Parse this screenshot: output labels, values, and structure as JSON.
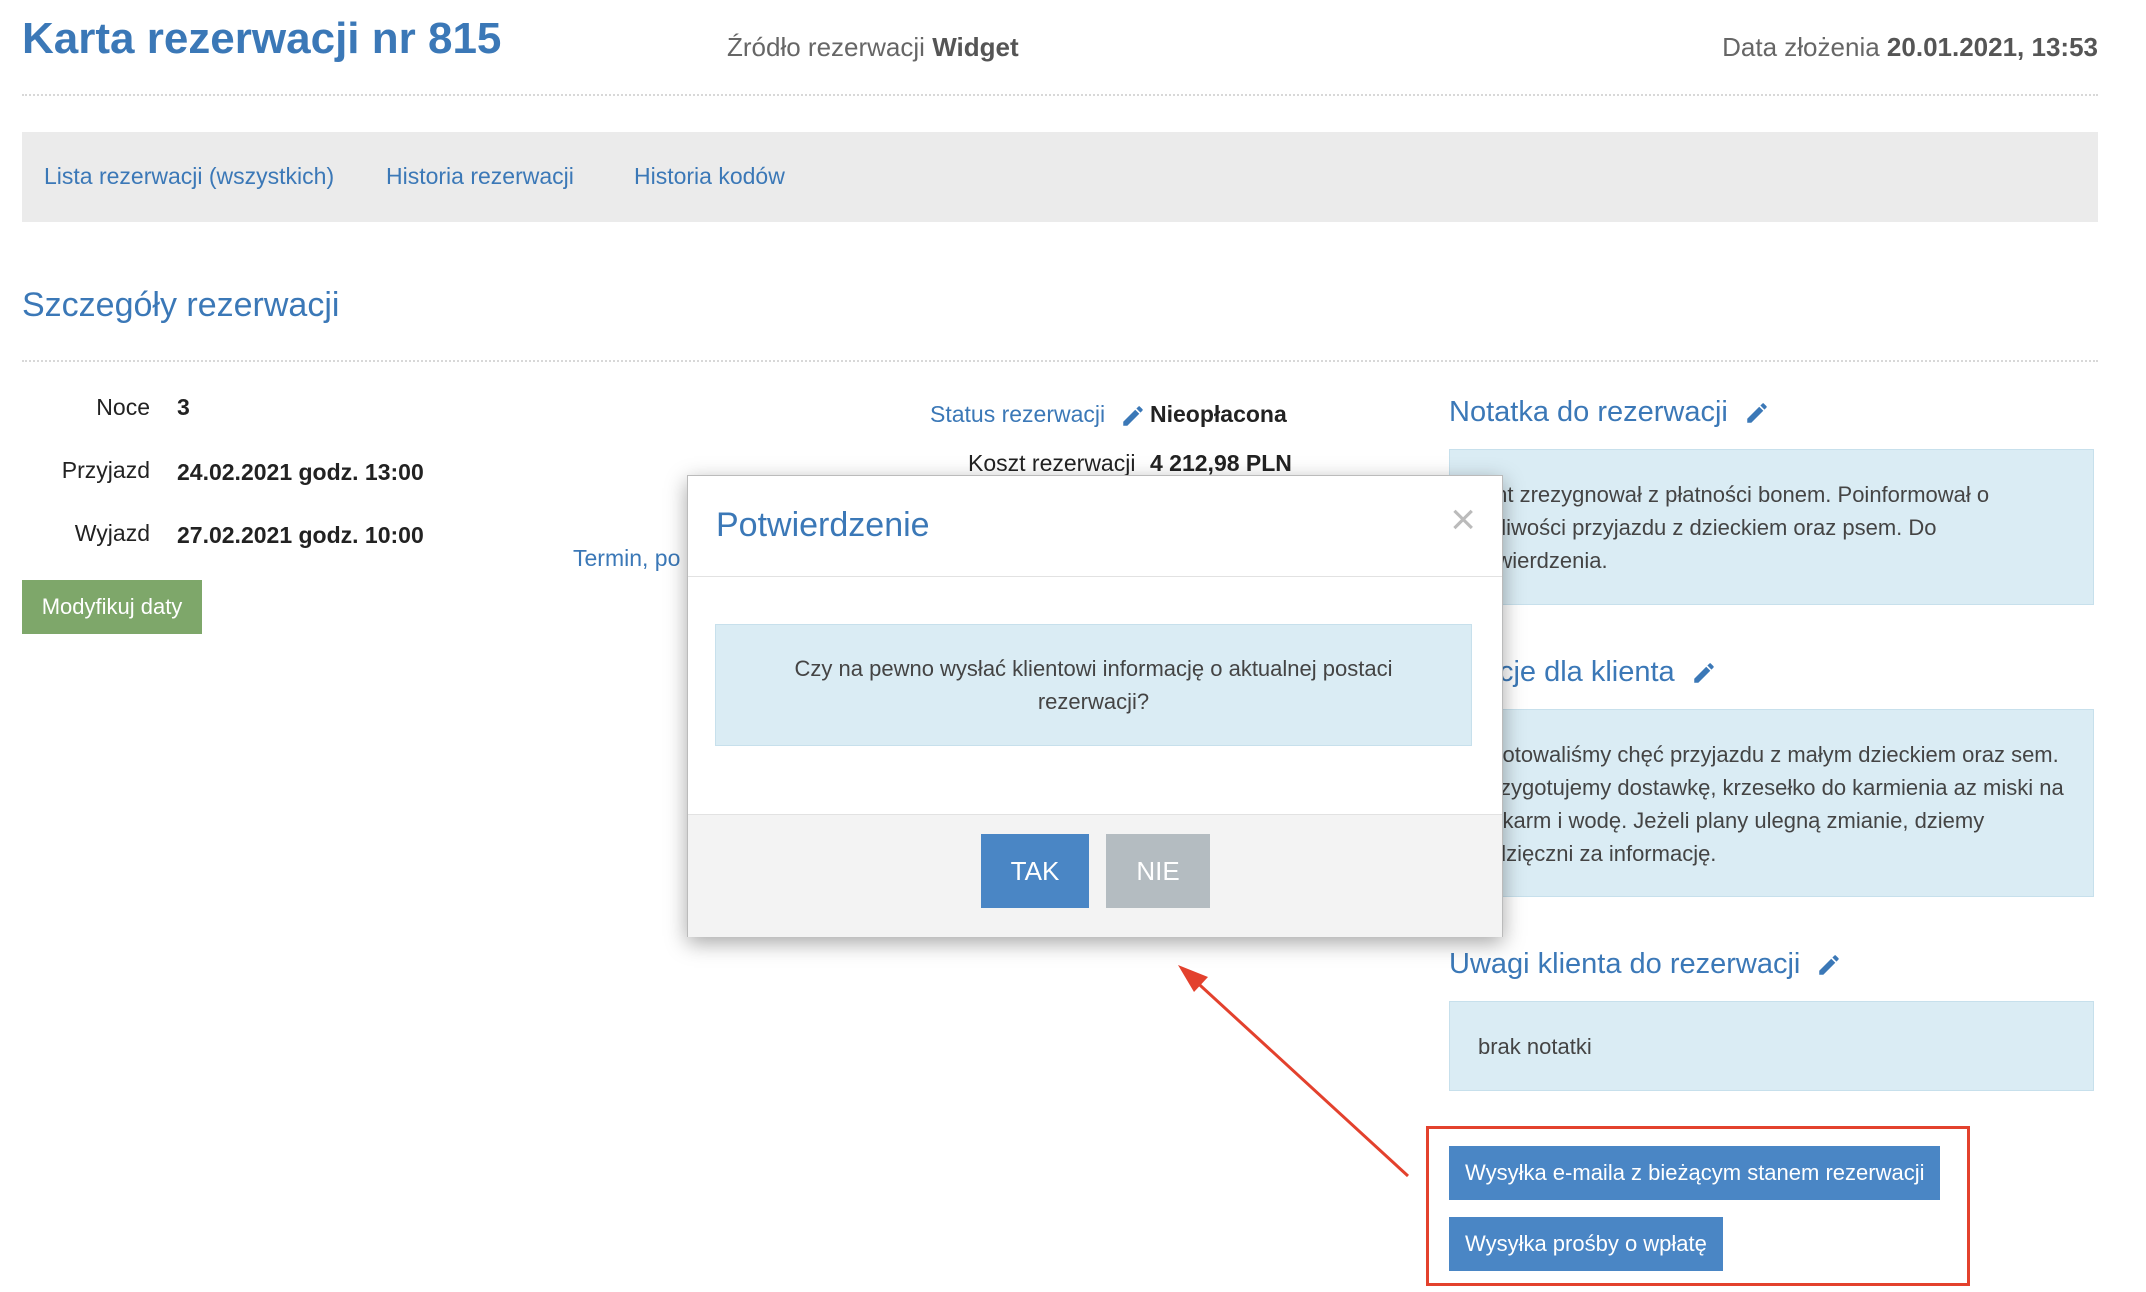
{
  "header": {
    "title": "Karta rezerwacji nr 815",
    "source_label": "Źródło rezerwacji",
    "source_value": "Widget",
    "date_label": "Data złożenia",
    "date_value": "20.01.2021, 13:53"
  },
  "nav": {
    "items": [
      {
        "label": "Lista rezerwacji (wszystkich)"
      },
      {
        "label": "Historia rezerwacji"
      },
      {
        "label": "Historia kodów"
      }
    ]
  },
  "details": {
    "section_title": "Szczegóły rezerwacji",
    "nights_label": "Noce",
    "nights_value": "3",
    "arrival_label": "Przyjazd",
    "arrival_value": "24.02.2021 godz. 13:00",
    "departure_label": "Wyjazd",
    "departure_value": "27.02.2021 godz. 10:00",
    "modify_button": "Modyfikuj daty",
    "status_label": "Status rezerwacji",
    "status_value": "Nieopłacona",
    "cost_label": "Koszt rezerwacji",
    "cost_value": "4 212,98 PLN",
    "termin_text": "Termin, po"
  },
  "right": {
    "note_title": "Notatka do rezerwacji",
    "note_text": "ient zrezygnował z płatności bonem. Poinformował o ożliwości przyjazdu z dzieckiem oraz psem. Do otwierdzenia.",
    "client_info_title": "rmacje dla klienta",
    "client_info_text": "dnotowaliśmy chęć przyjazdu z małym dzieckiem oraz sem. Przygotujemy dostawkę, krzesełko do karmienia az miski na pokarm i wodę. Jeżeli plany ulegną zmianie, dziemy wdzięczni za informację.",
    "remarks_title": "Uwagi klienta do rezerwacji",
    "remarks_text": "brak notatki",
    "send_email_button": "Wysyłka e-maila z bieżącym stanem rezerwacji",
    "send_payment_button": "Wysyłka prośby o wpłatę"
  },
  "modal": {
    "title": "Potwierdzenie",
    "close_symbol": "×",
    "message": "Czy na pewno wysłać klientowi informację o aktualnej postaci rezerwacji?",
    "yes_label": "TAK",
    "no_label": "NIE"
  },
  "colors": {
    "accent": "#3b78b7",
    "button_blue": "#4a86c5",
    "button_green": "#7ea76a",
    "info_box": "#daecf4",
    "annotation_red": "#e3412d"
  }
}
